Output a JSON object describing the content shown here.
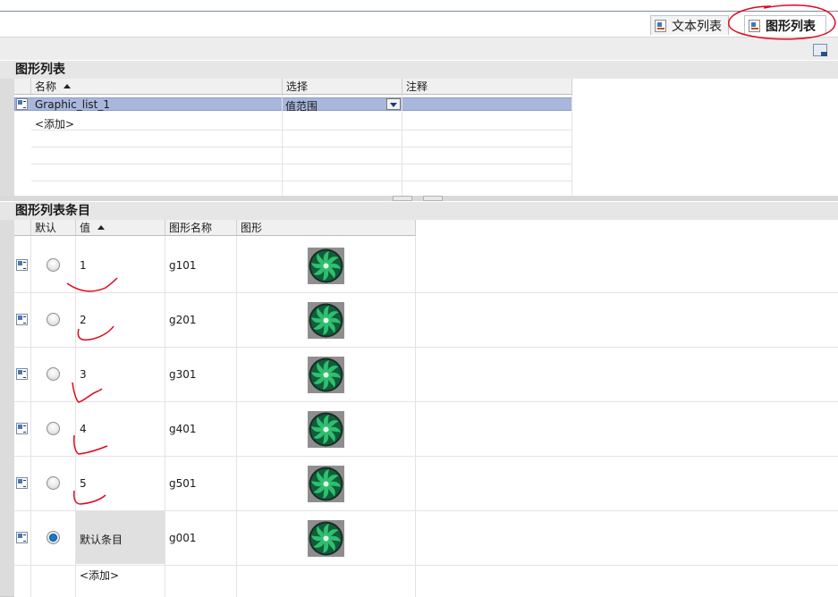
{
  "tabs": {
    "text_list": "文本列表",
    "graphic_list": "图形列表"
  },
  "graphic_lists": {
    "section_title": "图形列表",
    "columns": [
      "名称",
      "选择",
      "注释"
    ],
    "rows": [
      {
        "name": "Graphic_list_1",
        "selection": "值范围",
        "comment": ""
      }
    ],
    "add_label": "<添加>"
  },
  "entries": {
    "section_title": "图形列表条目",
    "columns": [
      "默认",
      "值",
      "图形名称",
      "图形"
    ],
    "rows": [
      {
        "value": "1",
        "graphic_name": "g101",
        "default": false
      },
      {
        "value": "2",
        "graphic_name": "g201",
        "default": false
      },
      {
        "value": "3",
        "graphic_name": "g301",
        "default": false
      },
      {
        "value": "4",
        "graphic_name": "g401",
        "default": false
      },
      {
        "value": "5",
        "graphic_name": "g501",
        "default": false
      },
      {
        "value": "默认条目",
        "graphic_name": "g001",
        "default": true
      }
    ],
    "add_label": "<添加>"
  },
  "colors": {
    "selection": "#a9b7dd",
    "annotation": "#e2061f",
    "fan_blade": "#2fbf6f"
  },
  "icons": [
    "text-list-icon",
    "graphic-list-icon",
    "dropdown-arrow-icon",
    "sort-ascending-icon",
    "graphic-entry-icon",
    "fan-graphic-icon"
  ]
}
